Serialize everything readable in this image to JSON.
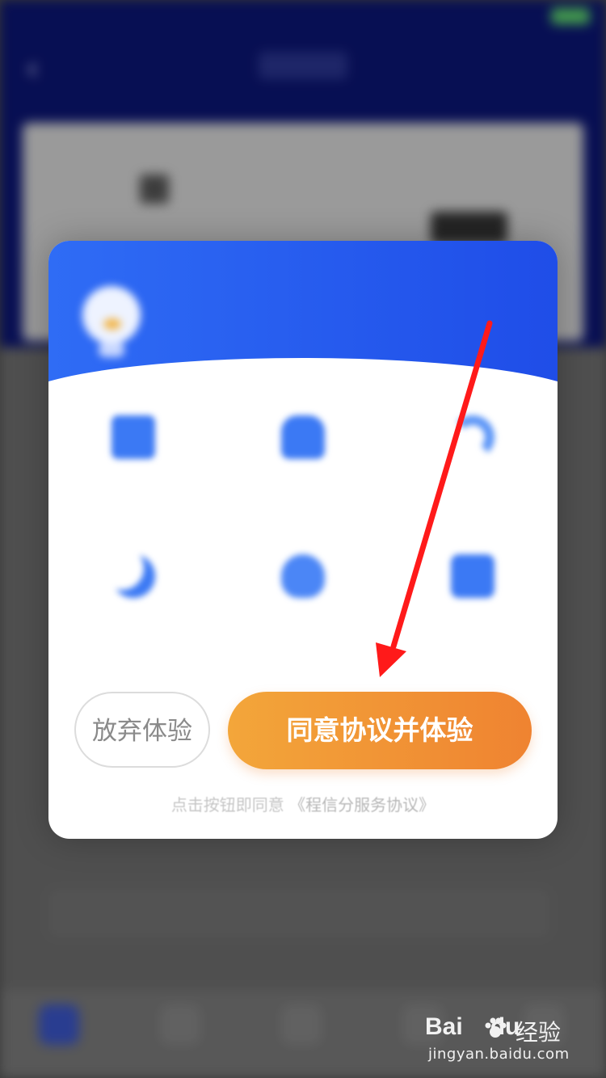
{
  "modal": {
    "head_subtitle": "",
    "head_title": "",
    "giveup_label": "放弃体验",
    "agree_label": "同意协议并体验",
    "agreement_prefix": "点击按钮即同意",
    "agreement_link": "《程信分服务协议》"
  },
  "benefits": [
    {
      "icon": "document-icon"
    },
    {
      "icon": "car-icon"
    },
    {
      "icon": "wifi-icon"
    },
    {
      "icon": "moon-icon"
    },
    {
      "icon": "cloud-icon"
    },
    {
      "icon": "box-icon"
    }
  ],
  "annotation": {
    "arrow_color": "#ff1a1a"
  },
  "watermark": {
    "logo": "Bai",
    "logo_suffix": "du",
    "cn": "经验",
    "url": "jingyan.baidu.com"
  },
  "colors": {
    "header_blue": "#0b1573",
    "modal_blue": "#2f6cf5",
    "agree_orange": "#ef8331"
  }
}
